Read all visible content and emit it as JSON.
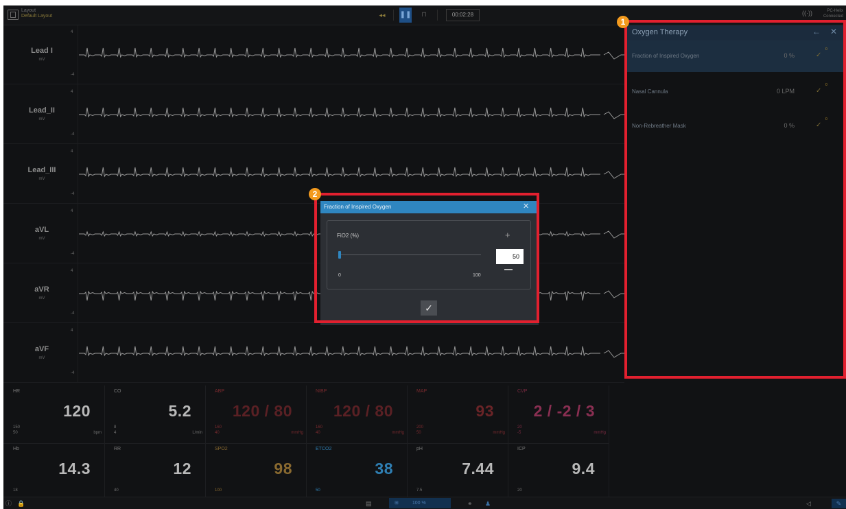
{
  "topbar": {
    "layout_title": "Layout",
    "layout_sub": "Default Layout",
    "rewind_icon": "◂◂",
    "pause_icon": "❚❚",
    "stop_icon": "⊓",
    "timer": "00:02:28",
    "connection_line1": "PC-Helix",
    "connection_line2": "Connected"
  },
  "leads": [
    {
      "name": "Lead I",
      "unit": "mV",
      "scale_top": "4",
      "scale_bottom": "-4"
    },
    {
      "name": "Lead_II",
      "unit": "mV",
      "scale_top": "4",
      "scale_bottom": "-4"
    },
    {
      "name": "Lead_III",
      "unit": "mV",
      "scale_top": "4",
      "scale_bottom": "-4"
    },
    {
      "name": "aVL",
      "unit": "mV",
      "scale_top": "4",
      "scale_bottom": "-4"
    },
    {
      "name": "aVR",
      "unit": "mV",
      "scale_top": "4",
      "scale_bottom": "-4"
    },
    {
      "name": "aVF",
      "unit": "mV",
      "scale_top": "4",
      "scale_bottom": "-4"
    }
  ],
  "vitals": [
    {
      "label": "HR",
      "value": "120",
      "hi": "150",
      "lo": "50",
      "unit": "bpm",
      "color": "#b9b9b9",
      "label_color": "#7a7a7a"
    },
    {
      "label": "CO",
      "value": "5.2",
      "hi": "8",
      "lo": "4",
      "unit": "L/min",
      "color": "#b9b9b9",
      "label_color": "#7a7a7a"
    },
    {
      "label": "ABP",
      "value": "120 / 80",
      "hi": "160",
      "lo": "40",
      "unit": "mmHg",
      "color": "#5a2024",
      "label_color": "#7a2a2e"
    },
    {
      "label": "NIBP",
      "value": "120 / 80",
      "hi": "160",
      "lo": "40",
      "unit": "mmHg",
      "color": "#5a2024",
      "label_color": "#7a2a2e"
    },
    {
      "label": "MAP",
      "value": "93",
      "hi": "200",
      "lo": "50",
      "unit": "mmHg",
      "color": "#6a2427",
      "label_color": "#7a2a2e"
    },
    {
      "label": "CVP",
      "value": "2 / -2 / 3",
      "hi": "20",
      "lo": "-5",
      "unit": "mmHg",
      "color": "#8a2f52",
      "label_color": "#7a2a40"
    },
    {
      "label": "Hb",
      "value": "14.3",
      "hi": "",
      "lo": "18",
      "unit": "",
      "color": "#b9b9b9",
      "label_color": "#7a7a7a"
    },
    {
      "label": "RR",
      "value": "12",
      "hi": "",
      "lo": "40",
      "unit": "",
      "color": "#b9b9b9",
      "label_color": "#7a7a7a"
    },
    {
      "label": "SPO2",
      "value": "98",
      "hi": "",
      "lo": "100",
      "unit": "",
      "color": "#8a6a30",
      "label_color": "#8a6a30"
    },
    {
      "label": "ETCO2",
      "value": "38",
      "hi": "",
      "lo": "50",
      "unit": "",
      "color": "#2f7fb3",
      "label_color": "#2f7fb3"
    },
    {
      "label": "pH",
      "value": "7.44",
      "hi": "",
      "lo": "7.5",
      "unit": "",
      "color": "#b9b9b9",
      "label_color": "#7a7a7a"
    },
    {
      "label": "ICP",
      "value": "9.4",
      "hi": "",
      "lo": "20",
      "unit": "",
      "color": "#b9b9b9",
      "label_color": "#7a7a7a"
    }
  ],
  "panel": {
    "title": "Oxygen Therapy",
    "back_icon": "←",
    "close_icon": "✕",
    "rows": [
      {
        "label": "Fraction of Inspired Oxygen",
        "value": "0 %",
        "badge": "0"
      },
      {
        "label": "Nasal Cannula",
        "value": "0 LPM",
        "badge": "0"
      },
      {
        "label": "Non-Rebreather Mask",
        "value": "0 %",
        "badge": "0"
      }
    ],
    "check_icon": "✓"
  },
  "dialog": {
    "title": "Fraction of Inspired Oxygen",
    "close_icon": "✕",
    "field_label": "FiO2 (%)",
    "plus_icon": "+",
    "input_value": "50",
    "slider_min": "0",
    "slider_max": "100",
    "slider_fraction": 0.0,
    "confirm_icon": "✓"
  },
  "callouts": {
    "panel": "1",
    "dialog": "2"
  },
  "bottombar": {
    "info_icon": "ⓘ",
    "lock_icon": "🔒",
    "doc_icon": "▤",
    "zoom_icon": "⊞",
    "zoom_value": "100 %",
    "binoc_icon": "⚭",
    "person_icon": "♟",
    "sound_icon": "◁",
    "edit_icon": "✎"
  },
  "colors": {
    "highlight": "#e2202f",
    "callout": "#f39a1e",
    "accent": "#2f86c0"
  }
}
